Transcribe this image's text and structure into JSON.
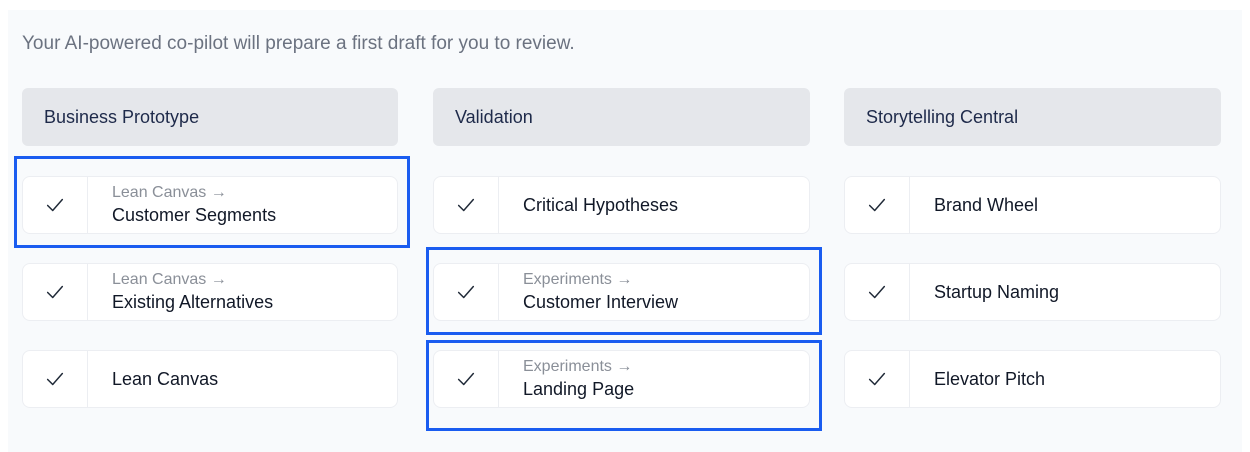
{
  "subtitle": "Your AI-powered co-pilot will prepare a first draft for you to review.",
  "columns": [
    {
      "header": "Business Prototype",
      "items": [
        {
          "crumb": "Lean Canvas →",
          "label": "Customer Segments",
          "checked": true,
          "highlighted": true
        },
        {
          "crumb": "Lean Canvas →",
          "label": "Existing Alternatives",
          "checked": true,
          "highlighted": false
        },
        {
          "crumb": "",
          "label": "Lean Canvas",
          "checked": true,
          "highlighted": false
        }
      ]
    },
    {
      "header": "Validation",
      "items": [
        {
          "crumb": "",
          "label": "Critical Hypotheses",
          "checked": true,
          "highlighted": false
        },
        {
          "crumb": "Experiments →",
          "label": "Customer Interview",
          "checked": true,
          "highlighted": true
        },
        {
          "crumb": "Experiments →",
          "label": "Landing Page",
          "checked": true,
          "highlighted": true
        }
      ]
    },
    {
      "header": "Storytelling Central",
      "items": [
        {
          "crumb": "",
          "label": "Brand Wheel",
          "checked": true,
          "highlighted": false
        },
        {
          "crumb": "",
          "label": "Startup Naming",
          "checked": true,
          "highlighted": false
        },
        {
          "crumb": "",
          "label": "Elevator Pitch",
          "checked": true,
          "highlighted": false
        }
      ]
    }
  ],
  "colors": {
    "highlight": "#1a5cf0",
    "header_bg": "#e5e7eb",
    "panel_bg": "#f8fafc"
  },
  "icons": {
    "check": "check-icon"
  }
}
